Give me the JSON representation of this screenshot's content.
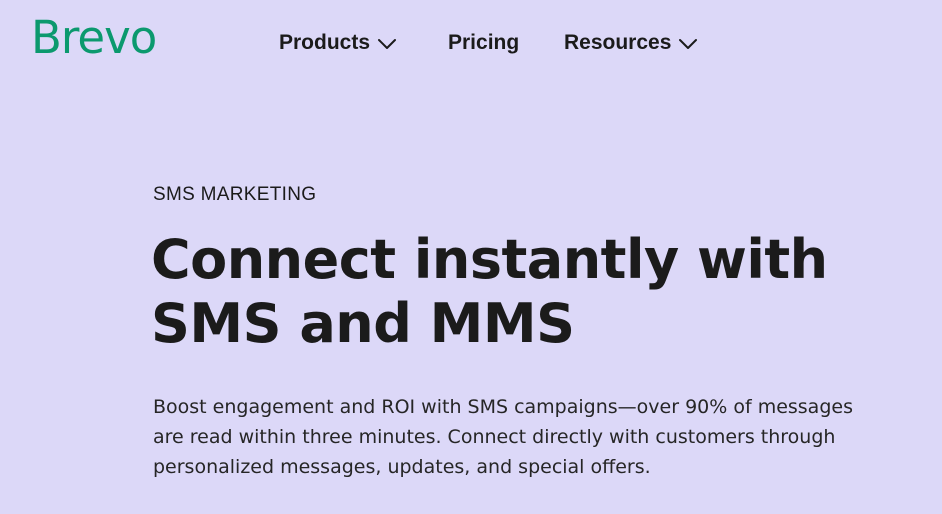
{
  "header": {
    "logo_text": "Brevo",
    "nav": [
      {
        "label": "Products",
        "icon": "chevron-down-icon"
      },
      {
        "label": "Pricing"
      },
      {
        "label": "Resources",
        "icon": "chevron-down-icon"
      }
    ]
  },
  "hero": {
    "eyebrow": "SMS MARKETING",
    "headline": "Connect instantly with SMS and MMS",
    "description": "Boost engagement and ROI with SMS campaigns—over 90% of messages are read within three minutes. Connect directly with customers through personalized messages, updates, and special offers."
  },
  "colors": {
    "background": "#dcd8f8",
    "brand": "#0b996e",
    "text": "#1b1b1b"
  }
}
